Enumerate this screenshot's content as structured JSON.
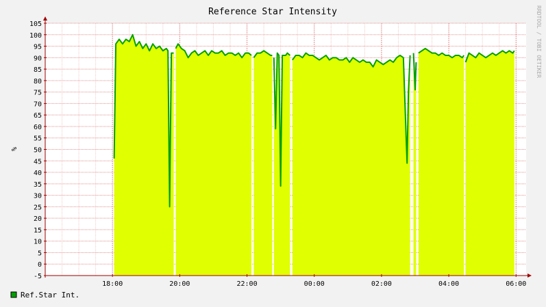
{
  "chart_data": {
    "type": "area",
    "title": "Reference Star Intensity",
    "ylabel": "%",
    "watermark": "RRDTOOL / TOBI OETIKER",
    "ylim": [
      -5,
      105
    ],
    "yticks": [
      -5,
      0,
      5,
      10,
      15,
      20,
      25,
      30,
      35,
      40,
      45,
      50,
      55,
      60,
      65,
      70,
      75,
      80,
      85,
      90,
      95,
      100,
      105
    ],
    "xlim_hours": [
      16.0,
      30.3
    ],
    "xticks": [
      {
        "label": "18:00",
        "hour": 18
      },
      {
        "label": "20:00",
        "hour": 20
      },
      {
        "label": "22:00",
        "hour": 22
      },
      {
        "label": "00:00",
        "hour": 24
      },
      {
        "label": "02:00",
        "hour": 26
      },
      {
        "label": "04:00",
        "hour": 28
      },
      {
        "label": "06:00",
        "hour": 30
      }
    ],
    "grid": true,
    "colors": {
      "fill": "#e0ff00",
      "line": "#00a000",
      "legend_swatch": "#00a000",
      "minor_grid": "#f3c9c9",
      "major_grid": "#e48f8f",
      "axis": "#a00000"
    },
    "legend": [
      {
        "label": "Ref.Star Int.",
        "color": "#00a000"
      }
    ],
    "series": [
      {
        "name": "Ref.Star Int.",
        "segments": [
          [
            [
              18.05,
              46
            ],
            [
              18.1,
              96
            ],
            [
              18.2,
              98
            ],
            [
              18.3,
              96
            ],
            [
              18.4,
              98
            ],
            [
              18.5,
              97
            ],
            [
              18.6,
              100
            ],
            [
              18.7,
              95
            ],
            [
              18.8,
              97
            ],
            [
              18.9,
              94
            ],
            [
              19.0,
              96
            ],
            [
              19.1,
              93
            ],
            [
              19.2,
              96
            ],
            [
              19.3,
              94
            ],
            [
              19.4,
              95
            ],
            [
              19.5,
              93
            ],
            [
              19.6,
              94
            ],
            [
              19.65,
              93
            ],
            [
              19.7,
              25
            ],
            [
              19.75,
              92
            ],
            [
              19.82,
              92
            ]
          ],
          [
            [
              19.88,
              94
            ],
            [
              19.95,
              96
            ],
            [
              20.05,
              94
            ],
            [
              20.15,
              93
            ],
            [
              20.25,
              90
            ],
            [
              20.35,
              92
            ],
            [
              20.45,
              93
            ],
            [
              20.55,
              91
            ],
            [
              20.65,
              92
            ],
            [
              20.75,
              93
            ],
            [
              20.85,
              91
            ],
            [
              20.95,
              93
            ],
            [
              21.05,
              92
            ],
            [
              21.15,
              92
            ],
            [
              21.25,
              93
            ],
            [
              21.35,
              91
            ],
            [
              21.45,
              92
            ],
            [
              21.55,
              92
            ],
            [
              21.65,
              91
            ],
            [
              21.75,
              92
            ],
            [
              21.85,
              90
            ],
            [
              21.95,
              92
            ],
            [
              22.05,
              92
            ],
            [
              22.13,
              91
            ]
          ],
          [
            [
              22.2,
              90
            ],
            [
              22.3,
              92
            ],
            [
              22.4,
              92
            ],
            [
              22.5,
              93
            ],
            [
              22.6,
              92
            ],
            [
              22.7,
              91
            ],
            [
              22.75,
              91
            ]
          ],
          [
            [
              22.8,
              90
            ],
            [
              22.85,
              59
            ],
            [
              22.9,
              92
            ],
            [
              22.95,
              91
            ],
            [
              23.0,
              34
            ],
            [
              23.05,
              91
            ],
            [
              23.15,
              91
            ],
            [
              23.2,
              92
            ],
            [
              23.28,
              91
            ]
          ],
          [
            [
              23.35,
              89
            ],
            [
              23.45,
              91
            ],
            [
              23.55,
              91
            ],
            [
              23.65,
              90
            ],
            [
              23.75,
              92
            ],
            [
              23.85,
              91
            ],
            [
              23.95,
              91
            ],
            [
              24.05,
              90
            ],
            [
              24.15,
              89
            ],
            [
              24.25,
              90
            ],
            [
              24.35,
              91
            ],
            [
              24.45,
              89
            ],
            [
              24.55,
              90
            ],
            [
              24.65,
              90
            ],
            [
              24.75,
              89
            ],
            [
              24.85,
              89
            ],
            [
              24.95,
              90
            ],
            [
              25.05,
              88
            ],
            [
              25.15,
              90
            ],
            [
              25.25,
              89
            ],
            [
              25.35,
              88
            ],
            [
              25.45,
              89
            ],
            [
              25.55,
              88
            ],
            [
              25.65,
              88
            ],
            [
              25.75,
              86
            ],
            [
              25.85,
              89
            ],
            [
              25.95,
              88
            ],
            [
              26.05,
              87
            ],
            [
              26.15,
              88
            ],
            [
              26.25,
              89
            ],
            [
              26.35,
              88
            ],
            [
              26.45,
              90
            ],
            [
              26.55,
              91
            ],
            [
              26.65,
              90
            ],
            [
              26.7,
              69
            ],
            [
              26.73,
              56
            ],
            [
              26.76,
              44
            ],
            [
              26.8,
              75
            ],
            [
              26.85,
              91
            ]
          ],
          [
            [
              26.95,
              92
            ],
            [
              27.0,
              76
            ],
            [
              27.03,
              88
            ]
          ],
          [
            [
              27.1,
              92
            ],
            [
              27.2,
              93
            ],
            [
              27.3,
              94
            ],
            [
              27.4,
              93
            ],
            [
              27.5,
              92
            ],
            [
              27.6,
              92
            ],
            [
              27.7,
              91
            ],
            [
              27.8,
              92
            ],
            [
              27.9,
              91
            ],
            [
              28.0,
              91
            ],
            [
              28.1,
              90
            ],
            [
              28.2,
              91
            ],
            [
              28.3,
              91
            ],
            [
              28.4,
              90
            ],
            [
              28.45,
              91
            ]
          ],
          [
            [
              28.5,
              88
            ],
            [
              28.6,
              92
            ],
            [
              28.7,
              91
            ],
            [
              28.8,
              90
            ],
            [
              28.9,
              92
            ],
            [
              29.0,
              91
            ],
            [
              29.1,
              90
            ],
            [
              29.2,
              91
            ],
            [
              29.3,
              92
            ],
            [
              29.4,
              91
            ],
            [
              29.5,
              92
            ],
            [
              29.6,
              93
            ],
            [
              29.7,
              92
            ],
            [
              29.8,
              93
            ],
            [
              29.9,
              92
            ],
            [
              29.95,
              93
            ]
          ]
        ]
      }
    ]
  }
}
